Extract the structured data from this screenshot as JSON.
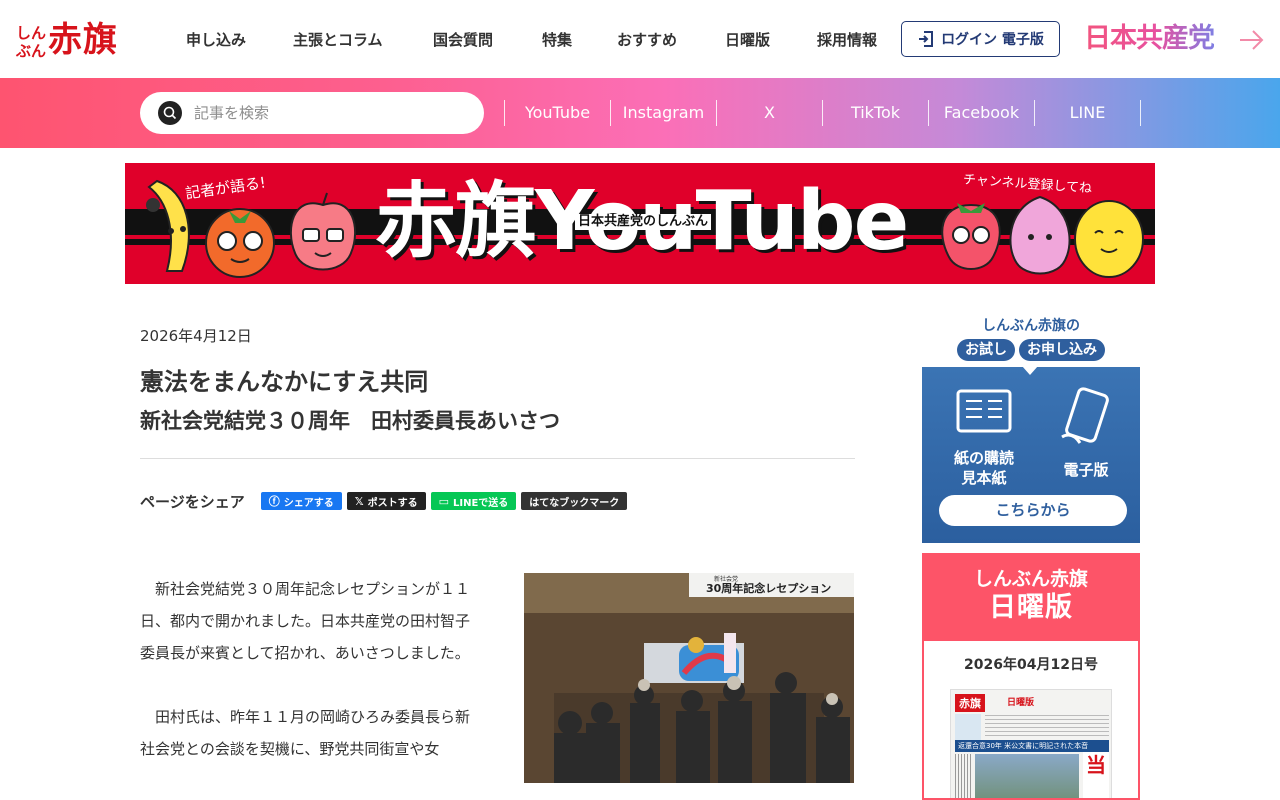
{
  "header": {
    "logo_small_1": "しん",
    "logo_small_2": "ぶん",
    "logo_big": "赤旗",
    "nav": [
      "申し込み",
      "主張とコラム",
      "国会質問",
      "特集",
      "おすすめ",
      "日曜版",
      "採用情報"
    ],
    "login_label": "ログイン 電子版",
    "party_logo": "日本共産党"
  },
  "search": {
    "placeholder": "記事を検索"
  },
  "social": [
    "YouTube",
    "Instagram",
    "X",
    "TikTok",
    "Facebook",
    "LINE"
  ],
  "banner": {
    "title": "赤旗YouTube",
    "subtitle": "日本共産党のしんぶん",
    "lead_left": "記者が語る!",
    "lead_right": "チャンネル登録してね"
  },
  "article": {
    "date": "2026年4月12日",
    "title": "憲法をまんなかにすえ共同",
    "subtitle": "新社会党結党３０周年　田村委員長あいさつ",
    "share_label": "ページをシェア",
    "share_buttons": [
      "シェアする",
      "ポストする",
      "LINEで送る",
      "はてなブックマーク"
    ],
    "paragraphs": [
      "新社会党結党３０周年記念レセプションが１１日、都内で開かれました。日本共産党の田村智子委員長が来賓として招かれ、あいさつしました。",
      "田村氏は、昨年１１月の岡崎ひろみ委員長ら新社会党との会談を契機に、野党共同街宣や女"
    ],
    "photo_caption_text": "30周年記念レセプション",
    "photo_caption_small": "新社会党"
  },
  "sidebar": {
    "trial_head": "しんぶん赤旗の",
    "trial_pill_1": "お試し",
    "trial_pill_2": "お申し込み",
    "trial_item_1": "紙の購読\n見本紙",
    "trial_item_1a": "紙の購読",
    "trial_item_1b": "見本紙",
    "trial_item_2": "電子版",
    "cta": "こちらから",
    "sunday_brand": "しんぶん赤旗",
    "sunday_title": "日曜版",
    "sunday_date": "2026年04月12日号",
    "paper_logo": "赤旗",
    "paper_label": "日曜版",
    "paper_headline": "返還合意30年 米公文書に明記された本音"
  },
  "colors": {
    "brand_red": "#d7131b",
    "navy": "#233a75",
    "sidebar_blue": "#2f5f9e",
    "sunday_pink": "#fd5468",
    "facebook": "#1877f2",
    "x": "#222222",
    "line": "#06c755",
    "hatena": "#333333"
  }
}
